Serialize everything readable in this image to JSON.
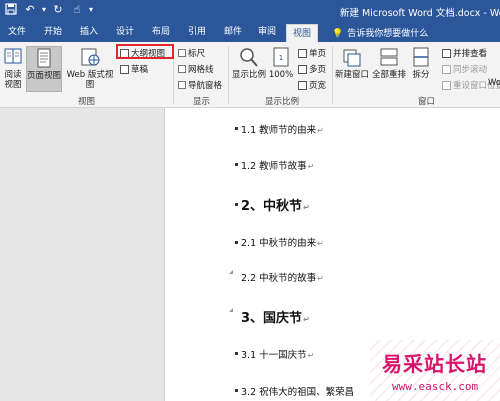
{
  "window": {
    "title": "新建 Microsoft Word 文档.docx - Word"
  },
  "qat": {
    "save_icon": "save-icon",
    "undo_icon": "undo-icon",
    "redo_icon": "redo-icon",
    "touch_icon": "touch-mode-icon",
    "customize": "▾"
  },
  "tabs": [
    {
      "label": "文件"
    },
    {
      "label": "开始"
    },
    {
      "label": "插入"
    },
    {
      "label": "设计"
    },
    {
      "label": "布局"
    },
    {
      "label": "引用"
    },
    {
      "label": "邮件"
    },
    {
      "label": "审阅"
    },
    {
      "label": "视图",
      "active": true
    }
  ],
  "tell_me": {
    "placeholder": "告诉我你想要做什么"
  },
  "ribbon": {
    "views": {
      "read": "阅读\n视图",
      "print": "页面视图",
      "web": "Web 版式视图",
      "outline": "大纲视图",
      "draft": "草稿",
      "label": "视图"
    },
    "show": {
      "ruler": "标尺",
      "gridlines": "网格线",
      "nav_pane": "导航窗格",
      "label": "显示"
    },
    "zoom": {
      "zoom": "显示比例",
      "hundred": "100%",
      "one_page": "单页",
      "multi_page": "多页",
      "page_width": "页宽",
      "label": "显示比例"
    },
    "window": {
      "new_window": "新建窗口",
      "arrange_all": "全部重排",
      "split": "拆分",
      "side_by_side": "并排查看",
      "sync_scroll": "同步滚动",
      "reset_pos": "重设窗口位置",
      "switch": "Word",
      "label": "窗口"
    }
  },
  "document": {
    "lines": [
      {
        "text": "1.1 教师节的由来",
        "level": 2
      },
      {
        "text": "1.2 教师节故事",
        "level": 2
      },
      {
        "text": "2、中秋节",
        "level": 1
      },
      {
        "text": "2.1   中秋节的由来",
        "level": 2
      },
      {
        "text": "2.2   中秋节的故事",
        "level": 2
      },
      {
        "text": "3、国庆节",
        "level": 1
      },
      {
        "text": "3.1  十一国庆节",
        "level": 2
      },
      {
        "text": "3.2   祝伟大的祖国、繁荣昌",
        "level": 2
      }
    ],
    "para_mark": "↵"
  },
  "watermark": {
    "brand": "易采站长站",
    "url": "www.easck.com"
  },
  "colors": {
    "accent": "#2b579a",
    "highlight": "#e0262c",
    "watermark": "#d9136b"
  }
}
